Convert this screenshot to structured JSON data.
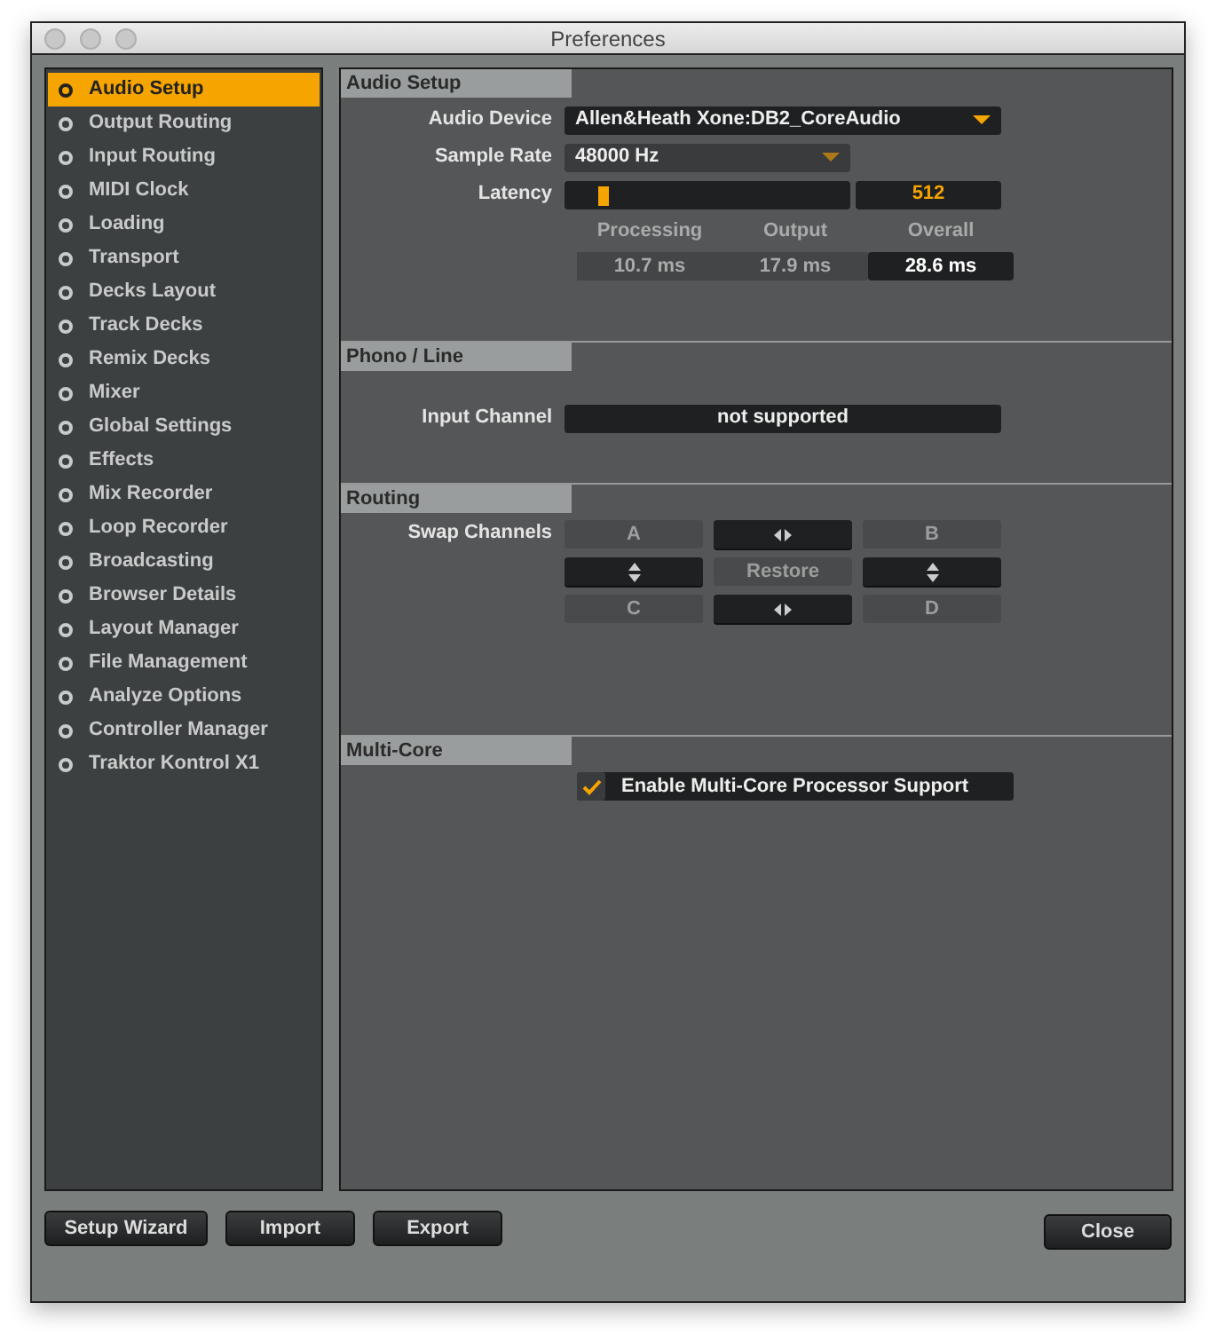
{
  "window": {
    "title": "Preferences"
  },
  "sidebar": {
    "items": [
      {
        "label": "Audio Setup",
        "selected": true
      },
      {
        "label": "Output Routing",
        "selected": false
      },
      {
        "label": "Input Routing",
        "selected": false
      },
      {
        "label": "MIDI Clock",
        "selected": false
      },
      {
        "label": "Loading",
        "selected": false
      },
      {
        "label": "Transport",
        "selected": false
      },
      {
        "label": "Decks Layout",
        "selected": false
      },
      {
        "label": "Track Decks",
        "selected": false
      },
      {
        "label": "Remix Decks",
        "selected": false
      },
      {
        "label": "Mixer",
        "selected": false
      },
      {
        "label": "Global Settings",
        "selected": false
      },
      {
        "label": "Effects",
        "selected": false
      },
      {
        "label": "Mix Recorder",
        "selected": false
      },
      {
        "label": "Loop Recorder",
        "selected": false
      },
      {
        "label": "Broadcasting",
        "selected": false
      },
      {
        "label": "Browser Details",
        "selected": false
      },
      {
        "label": "Layout Manager",
        "selected": false
      },
      {
        "label": "File Management",
        "selected": false
      },
      {
        "label": "Analyze Options",
        "selected": false
      },
      {
        "label": "Controller Manager",
        "selected": false
      },
      {
        "label": "Traktor Kontrol X1",
        "selected": false
      }
    ]
  },
  "audio_setup": {
    "title": "Audio Setup",
    "audio_device": {
      "label": "Audio Device",
      "value": "Allen&Heath Xone:DB2_CoreAudio"
    },
    "sample_rate": {
      "label": "Sample Rate",
      "value": "48000 Hz"
    },
    "latency": {
      "label": "Latency",
      "level": 0.12,
      "value": "512"
    },
    "timings": [
      {
        "heading": "Processing",
        "value": "10.7 ms"
      },
      {
        "heading": "Output",
        "value": "17.9 ms"
      },
      {
        "heading": "Overall",
        "value": "28.6 ms"
      }
    ]
  },
  "phono_line": {
    "title": "Phono / Line",
    "input_channel": {
      "label": "Input Channel",
      "value": "not supported"
    }
  },
  "routing": {
    "title": "Routing",
    "label": "Swap Channels",
    "buttons": [
      {
        "kind": "text",
        "label": "A",
        "disabled": true
      },
      {
        "kind": "horizontal",
        "disabled": false
      },
      {
        "kind": "text",
        "label": "B",
        "disabled": true
      },
      {
        "kind": "vertical",
        "disabled": false
      },
      {
        "kind": "text",
        "label": "Restore",
        "disabled": true
      },
      {
        "kind": "vertical",
        "disabled": false
      },
      {
        "kind": "text",
        "label": "C",
        "disabled": true
      },
      {
        "kind": "horizontal",
        "disabled": false
      },
      {
        "kind": "text",
        "label": "D",
        "disabled": true
      }
    ]
  },
  "multi_core": {
    "title": "Multi-Core",
    "option": {
      "label": "Enable Multi-Core Processor Support",
      "checked": true
    }
  },
  "footer_buttons": [
    "Setup Wizard",
    "Import",
    "Export"
  ],
  "close_button": "Close"
}
